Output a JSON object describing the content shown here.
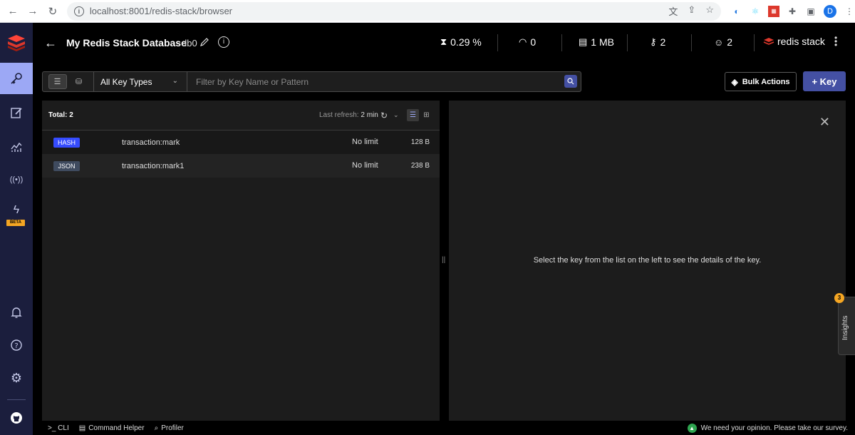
{
  "browser": {
    "url": "localhost:8001/redis-stack/browser",
    "avatar_letter": "D"
  },
  "topbar": {
    "db_name": "My Redis Stack Database",
    "db_index": "db0",
    "cpu": "0.29 %",
    "ops": "0",
    "memory": "1 MB",
    "keys": "2",
    "clients": "2",
    "brand": "redis stack"
  },
  "sidebar": {
    "beta_label": "BETA"
  },
  "filter": {
    "type_select": "All Key Types",
    "search_placeholder": "Filter by Key Name or Pattern",
    "bulk_actions": "Bulk Actions",
    "add_key": "+ Key"
  },
  "list": {
    "total": "Total: 2",
    "last_refresh_label": "Last refresh:",
    "last_refresh_value": "2 min",
    "rows": [
      {
        "type": "HASH",
        "name": "transaction:mark",
        "ttl": "No limit",
        "size": "128 B"
      },
      {
        "type": "JSON",
        "name": "transaction:mark1",
        "ttl": "No limit",
        "size": "238 B"
      }
    ]
  },
  "detail": {
    "empty_message": "Select the key from the list on the left to see the details of the key."
  },
  "insights": {
    "label": "Insights",
    "count": "3"
  },
  "bottombar": {
    "cli": ">_ CLI",
    "command_helper": "Command Helper",
    "profiler": "Profiler",
    "survey": "We need your opinion. Please take our survey."
  },
  "colors": {
    "accent": "#4450a3",
    "sidebar_bg": "#1b1e3d",
    "active_nav": "#9ca8f5",
    "hash_badge": "#364cff",
    "json_badge": "#3f4b5f",
    "redis_red": "#dc382c"
  }
}
